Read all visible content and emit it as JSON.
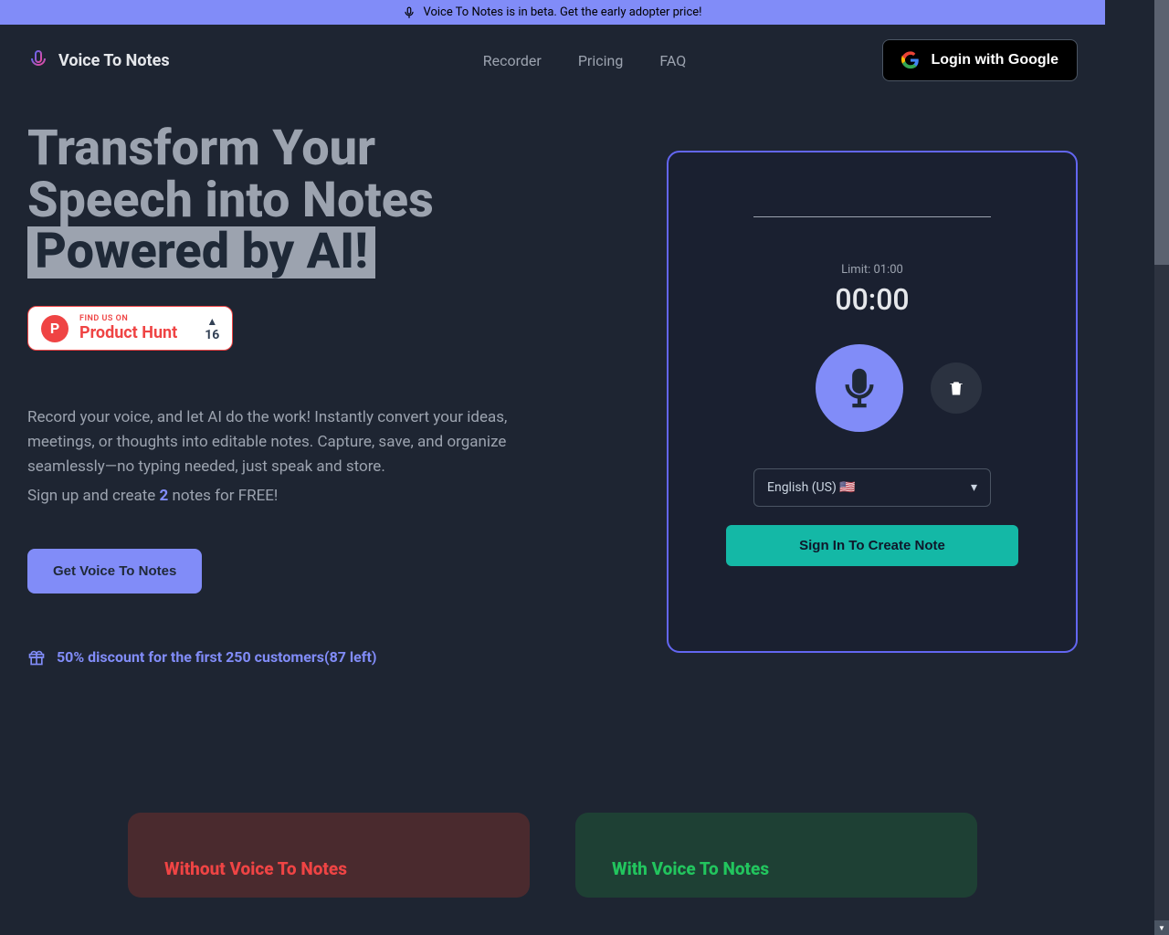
{
  "banner": {
    "text": "Voice To Notes is in beta. Get the early adopter price!"
  },
  "header": {
    "brand": "Voice To Notes",
    "nav": {
      "recorder": "Recorder",
      "pricing": "Pricing",
      "faq": "FAQ"
    },
    "login": "Login with Google"
  },
  "hero": {
    "line1": "Transform Your",
    "line2": "Speech into Notes",
    "line3": "Powered by AI!",
    "ph_small": "FIND US ON",
    "ph_big": "Product Hunt",
    "ph_count": "16",
    "desc1": "Record your voice, and let AI do the work! Instantly convert your ideas, meetings, or thoughts into editable notes. Capture, save, and organize seamlessly—no typing needed, just speak and store.",
    "desc2_a": "Sign up and create ",
    "desc2_num": "2",
    "desc2_b": " notes for FREE!",
    "cta": "Get Voice To Notes",
    "discount": "50% discount for the first 250 customers(87 left)"
  },
  "recorder": {
    "limit": "Limit: 01:00",
    "timer": "00:00",
    "language": "English (US) 🇺🇸",
    "signin": "Sign In To Create Note"
  },
  "compare": {
    "without": "Without Voice To Notes",
    "with": "With Voice To Notes"
  }
}
